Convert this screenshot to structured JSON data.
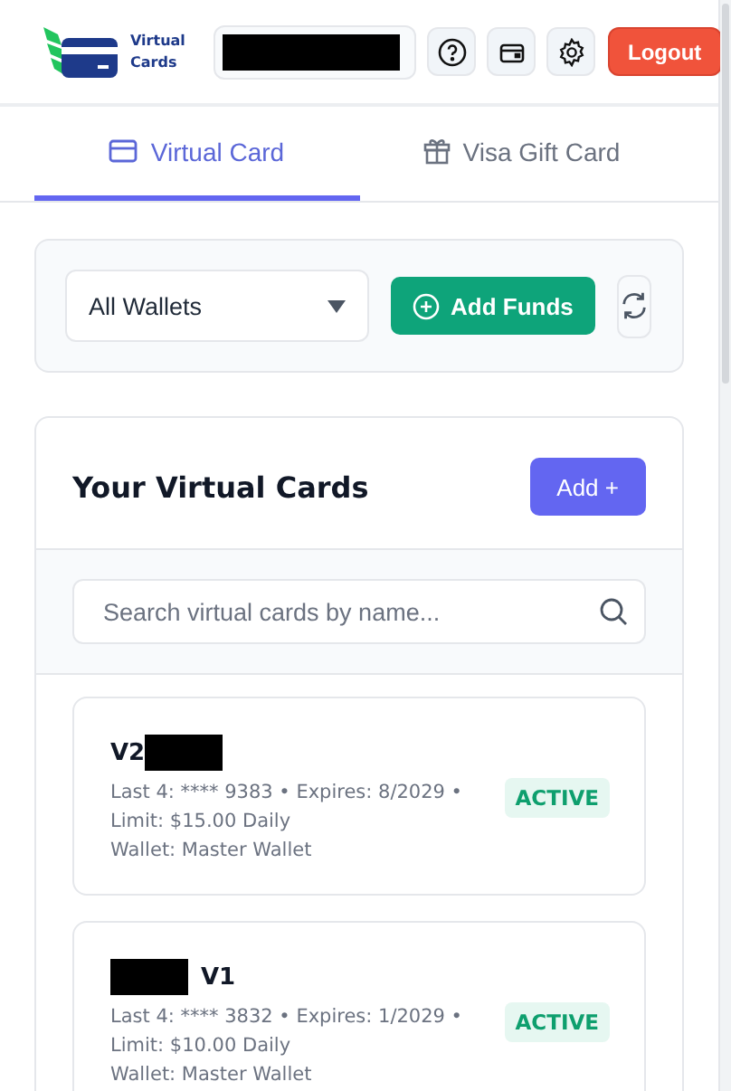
{
  "header": {
    "logo_text": "Virtual Cards",
    "buttons": [
      "Logout"
    ]
  },
  "tabs": [
    {
      "label": "Virtual Card",
      "selected": true
    },
    {
      "label": "Visa Gift Card",
      "selected": false
    }
  ],
  "wallet_bar": {
    "wallet_select": "All Wallets",
    "add_funds": "Add Funds"
  },
  "cards_panel": {
    "title": "Your Virtual Cards",
    "add_button": "Add +",
    "search": {
      "placeholder": "Search virtual cards by name..."
    },
    "cards": [
      {
        "name": "V2",
        "details": "Last 4: **** 9383 • Expires: 8/2029 • Limit: $15.00 Daily",
        "wallet": "Wallet: Master Wallet",
        "status": "ACTIVE"
      },
      {
        "name": "V1",
        "details": "Last 4: **** 3832 • Expires: 1/2029 • Limit: $10.00 Daily",
        "wallet": "Wallet: Master Wallet",
        "status": "ACTIVE"
      }
    ]
  }
}
